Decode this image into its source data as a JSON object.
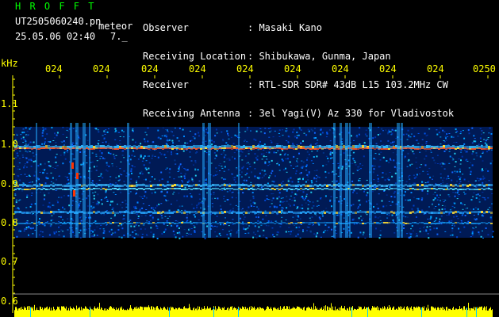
{
  "header": {
    "app_name": "H R O F F T",
    "file_name": "UT2505060240.pn",
    "file_suffix": "meteor",
    "date_time": "25.05.06 02:40",
    "extra": "7._",
    "rows": [
      {
        "label": "Observer",
        "value": ": Masaki Kano"
      },
      {
        "label": "Receiving Location",
        "value": ": Shibukawa, Gunma, Japan"
      },
      {
        "label": "Receiver",
        "value": ": RTL-SDR SDR# 43dB L15 103.2MHz CW"
      },
      {
        "label": "Receiving Antenna",
        "value": ": 3el Yagi(V) Az 330 for Vladivostok"
      }
    ]
  },
  "axis": {
    "y_unit": "kHz",
    "y_ticks": [
      "1.1",
      "1.0",
      "0.9",
      "0.8",
      "0.7",
      "0.6"
    ],
    "x_ticks": [
      "024",
      "024",
      "024",
      "024",
      "024",
      "024",
      "024",
      "024",
      "024",
      "0250"
    ]
  },
  "colors": {
    "label": "#ffff00",
    "title": "#00ff00",
    "text": "#ffffff",
    "background": "#000000"
  }
}
